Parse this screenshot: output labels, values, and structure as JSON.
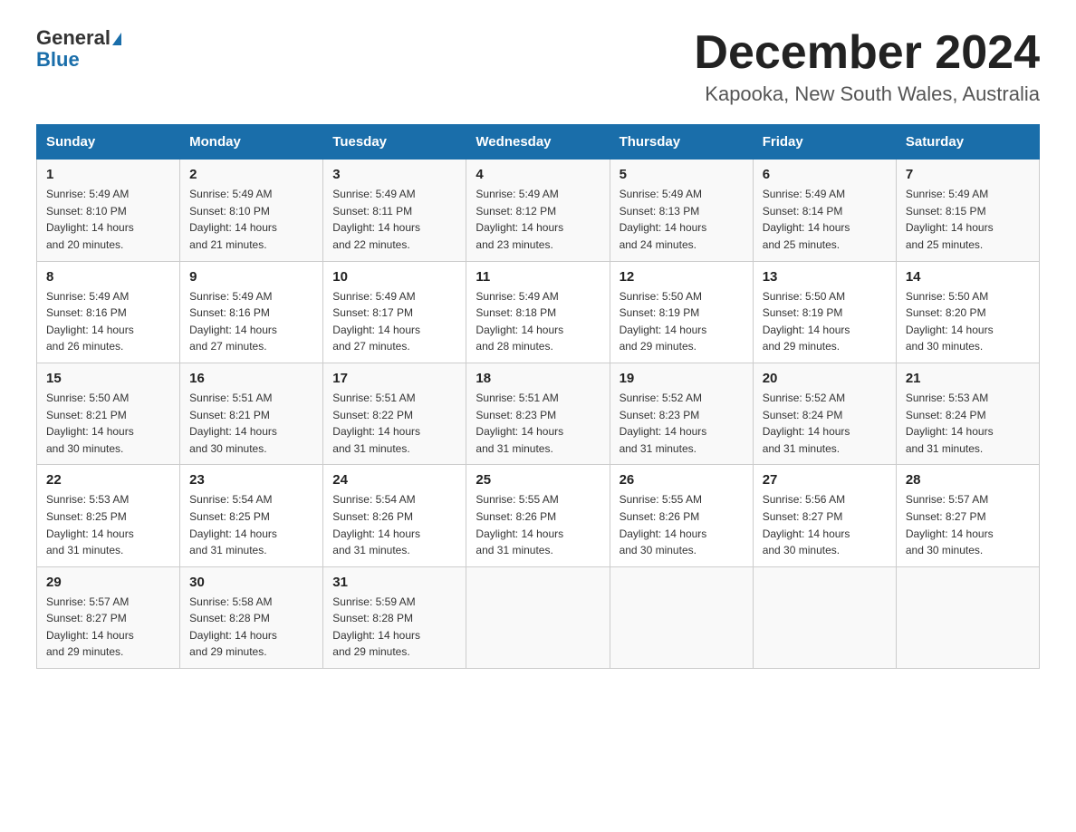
{
  "header": {
    "logo_general": "General",
    "logo_blue": "Blue",
    "title": "December 2024",
    "subtitle": "Kapooka, New South Wales, Australia"
  },
  "days_of_week": [
    "Sunday",
    "Monday",
    "Tuesday",
    "Wednesday",
    "Thursday",
    "Friday",
    "Saturday"
  ],
  "weeks": [
    [
      {
        "day": "1",
        "sunrise": "5:49 AM",
        "sunset": "8:10 PM",
        "daylight": "14 hours and 20 minutes."
      },
      {
        "day": "2",
        "sunrise": "5:49 AM",
        "sunset": "8:10 PM",
        "daylight": "14 hours and 21 minutes."
      },
      {
        "day": "3",
        "sunrise": "5:49 AM",
        "sunset": "8:11 PM",
        "daylight": "14 hours and 22 minutes."
      },
      {
        "day": "4",
        "sunrise": "5:49 AM",
        "sunset": "8:12 PM",
        "daylight": "14 hours and 23 minutes."
      },
      {
        "day": "5",
        "sunrise": "5:49 AM",
        "sunset": "8:13 PM",
        "daylight": "14 hours and 24 minutes."
      },
      {
        "day": "6",
        "sunrise": "5:49 AM",
        "sunset": "8:14 PM",
        "daylight": "14 hours and 25 minutes."
      },
      {
        "day": "7",
        "sunrise": "5:49 AM",
        "sunset": "8:15 PM",
        "daylight": "14 hours and 25 minutes."
      }
    ],
    [
      {
        "day": "8",
        "sunrise": "5:49 AM",
        "sunset": "8:16 PM",
        "daylight": "14 hours and 26 minutes."
      },
      {
        "day": "9",
        "sunrise": "5:49 AM",
        "sunset": "8:16 PM",
        "daylight": "14 hours and 27 minutes."
      },
      {
        "day": "10",
        "sunrise": "5:49 AM",
        "sunset": "8:17 PM",
        "daylight": "14 hours and 27 minutes."
      },
      {
        "day": "11",
        "sunrise": "5:49 AM",
        "sunset": "8:18 PM",
        "daylight": "14 hours and 28 minutes."
      },
      {
        "day": "12",
        "sunrise": "5:50 AM",
        "sunset": "8:19 PM",
        "daylight": "14 hours and 29 minutes."
      },
      {
        "day": "13",
        "sunrise": "5:50 AM",
        "sunset": "8:19 PM",
        "daylight": "14 hours and 29 minutes."
      },
      {
        "day": "14",
        "sunrise": "5:50 AM",
        "sunset": "8:20 PM",
        "daylight": "14 hours and 30 minutes."
      }
    ],
    [
      {
        "day": "15",
        "sunrise": "5:50 AM",
        "sunset": "8:21 PM",
        "daylight": "14 hours and 30 minutes."
      },
      {
        "day": "16",
        "sunrise": "5:51 AM",
        "sunset": "8:21 PM",
        "daylight": "14 hours and 30 minutes."
      },
      {
        "day": "17",
        "sunrise": "5:51 AM",
        "sunset": "8:22 PM",
        "daylight": "14 hours and 31 minutes."
      },
      {
        "day": "18",
        "sunrise": "5:51 AM",
        "sunset": "8:23 PM",
        "daylight": "14 hours and 31 minutes."
      },
      {
        "day": "19",
        "sunrise": "5:52 AM",
        "sunset": "8:23 PM",
        "daylight": "14 hours and 31 minutes."
      },
      {
        "day": "20",
        "sunrise": "5:52 AM",
        "sunset": "8:24 PM",
        "daylight": "14 hours and 31 minutes."
      },
      {
        "day": "21",
        "sunrise": "5:53 AM",
        "sunset": "8:24 PM",
        "daylight": "14 hours and 31 minutes."
      }
    ],
    [
      {
        "day": "22",
        "sunrise": "5:53 AM",
        "sunset": "8:25 PM",
        "daylight": "14 hours and 31 minutes."
      },
      {
        "day": "23",
        "sunrise": "5:54 AM",
        "sunset": "8:25 PM",
        "daylight": "14 hours and 31 minutes."
      },
      {
        "day": "24",
        "sunrise": "5:54 AM",
        "sunset": "8:26 PM",
        "daylight": "14 hours and 31 minutes."
      },
      {
        "day": "25",
        "sunrise": "5:55 AM",
        "sunset": "8:26 PM",
        "daylight": "14 hours and 31 minutes."
      },
      {
        "day": "26",
        "sunrise": "5:55 AM",
        "sunset": "8:26 PM",
        "daylight": "14 hours and 30 minutes."
      },
      {
        "day": "27",
        "sunrise": "5:56 AM",
        "sunset": "8:27 PM",
        "daylight": "14 hours and 30 minutes."
      },
      {
        "day": "28",
        "sunrise": "5:57 AM",
        "sunset": "8:27 PM",
        "daylight": "14 hours and 30 minutes."
      }
    ],
    [
      {
        "day": "29",
        "sunrise": "5:57 AM",
        "sunset": "8:27 PM",
        "daylight": "14 hours and 29 minutes."
      },
      {
        "day": "30",
        "sunrise": "5:58 AM",
        "sunset": "8:28 PM",
        "daylight": "14 hours and 29 minutes."
      },
      {
        "day": "31",
        "sunrise": "5:59 AM",
        "sunset": "8:28 PM",
        "daylight": "14 hours and 29 minutes."
      },
      null,
      null,
      null,
      null
    ]
  ],
  "sunrise_label": "Sunrise:",
  "sunset_label": "Sunset:",
  "daylight_label": "Daylight:"
}
